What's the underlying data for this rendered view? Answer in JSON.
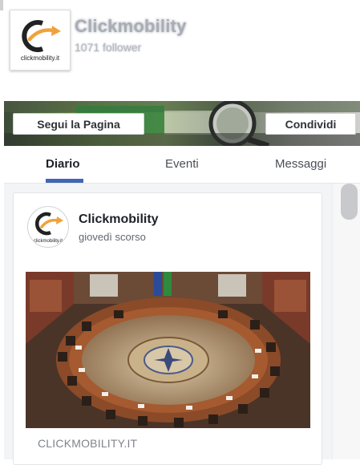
{
  "page": {
    "name": "Clickmobility",
    "followers": "1071 follower",
    "logo_text": "clickmobility.it"
  },
  "actions": {
    "follow_label": "Segui la Pagina",
    "share_label": "Condividi"
  },
  "tabs": [
    {
      "label": "Diario",
      "active": true
    },
    {
      "label": "Eventi",
      "active": false
    },
    {
      "label": "Messaggi",
      "active": false
    }
  ],
  "post": {
    "author": "Clickmobility",
    "time": "giovedì scorso",
    "logo_text": "clickmobility.it",
    "link_domain": "CLICKMOBILITY.IT"
  },
  "colors": {
    "accent": "#4267b2",
    "logo_orange": "#f0a23a"
  },
  "icons": [
    "clickmobility-logo-icon"
  ]
}
